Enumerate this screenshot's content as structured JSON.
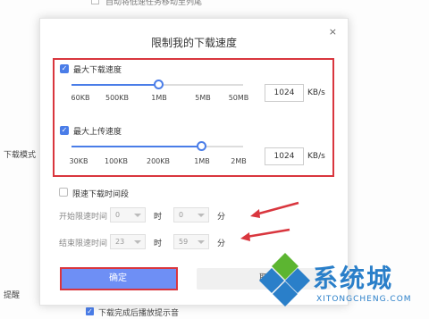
{
  "background": {
    "top_option_label": "自动将低速任务移动至列尾",
    "side_download_mode": "下载模式",
    "side_reminder": "提醒",
    "bottom_option_label": "下载完成后播放提示音"
  },
  "dialog": {
    "title": "限制我的下载速度",
    "close": "×",
    "download": {
      "label": "最大下载速度",
      "checked": true,
      "ticks": [
        "60KB",
        "500KB",
        "1MB",
        "5MB",
        "50MB"
      ],
      "value": "1024",
      "unit": "KB/s"
    },
    "upload": {
      "label": "最大上传速度",
      "checked": true,
      "ticks": [
        "30KB",
        "100KB",
        "200KB",
        "1MB",
        "2MB"
      ],
      "value": "1024",
      "unit": "KB/s"
    },
    "time_limit": {
      "label": "限速下载时间段",
      "checked": false,
      "start_label": "开始限速时间",
      "start_hour": "0",
      "start_minute": "0",
      "end_label": "结束限速时间",
      "end_hour": "23",
      "end_minute": "59",
      "hour_unit": "时",
      "minute_unit": "分"
    },
    "ok_label": "确定",
    "cancel_label": "取"
  },
  "watermark": {
    "text": "系统城",
    "url": "XITONGCHENG.COM"
  },
  "colors": {
    "accent": "#4a7de8",
    "annotation_red": "#d9363e",
    "watermark_blue": "#2a7fc9",
    "watermark_green": "#5cb531"
  }
}
